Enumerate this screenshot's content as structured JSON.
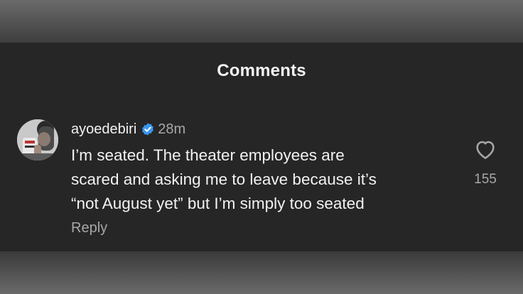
{
  "header": {
    "title": "Comments"
  },
  "comment": {
    "username": "ayoedebiri",
    "verified": true,
    "timestamp": "28m",
    "text_lines": [
      "I’m seated. The theater employees are",
      "scared and asking me to leave because it’s",
      "“not August yet” but I’m simply too seated"
    ],
    "reply_label": "Reply",
    "like_count": "155"
  },
  "icons": {
    "verified": "verified-badge-icon",
    "like": "heart-outline-icon"
  },
  "colors": {
    "panel_background": "#262626",
    "primary_text": "#f2f2f2",
    "secondary_text": "#a8a8a8",
    "verified_badge": "#3897f0"
  }
}
